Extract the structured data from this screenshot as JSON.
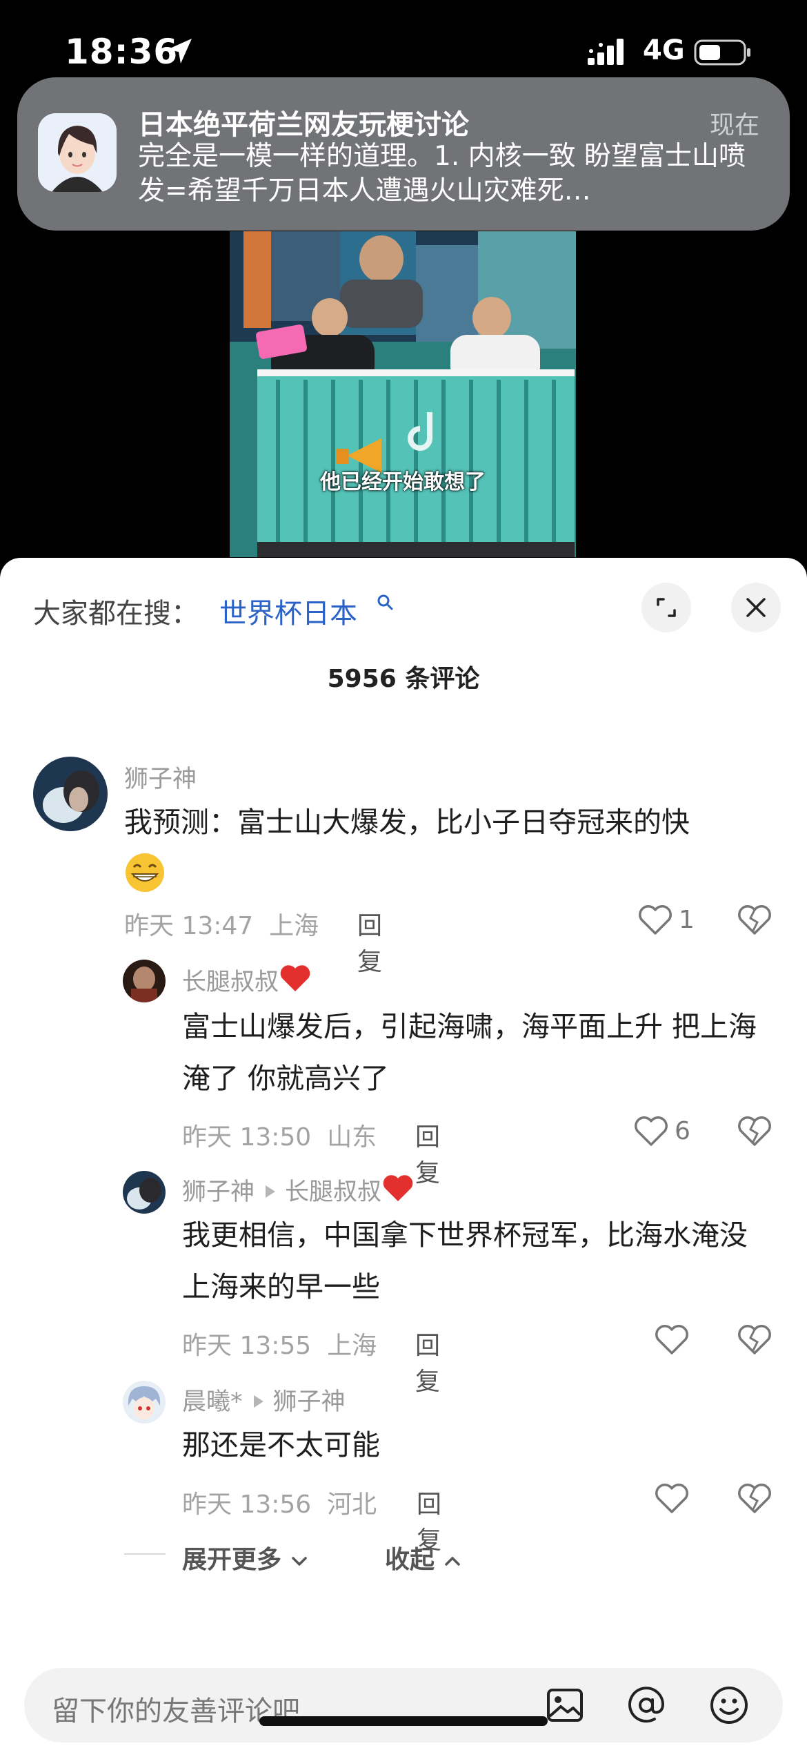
{
  "status_bar": {
    "time": "18:36",
    "network": "4G",
    "icons": [
      "location-arrow-icon",
      "signal-icon",
      "battery-icon"
    ]
  },
  "notification": {
    "title": "日本绝平荷兰网友玩梗讨论",
    "time": "现在",
    "body": "完全是一模一样的道理。1. 内核一致 盼望富士山喷发=希望千万日本人遭遇火山灾难死…"
  },
  "video": {
    "caption": "他已经开始敢想了",
    "icons": [
      "video-frame-image"
    ]
  },
  "sheet": {
    "search_label": "大家都在搜：",
    "search_term": "世界杯日本",
    "comment_count": "5956 条评论",
    "icons": [
      "search-icon",
      "expand-icon",
      "close-icon"
    ]
  },
  "comments": [
    {
      "name": "狮子神",
      "text": "我预测：富士山大爆发，比小子日夺冠来的快",
      "date": "昨天 13:47",
      "location": "上海",
      "reply_label": "回复",
      "likes": "1"
    },
    {
      "name": "长腿叔叔",
      "text": "富士山爆发后，引起海啸，海平面上升 把上海淹了 你就高兴了",
      "date": "昨天 13:50",
      "location": "山东",
      "reply_label": "回复",
      "likes": "6"
    },
    {
      "name": "狮子神",
      "reply_to": "长腿叔叔",
      "text": "我更相信，中国拿下世界杯冠军，比海水淹没上海来的早一些",
      "date": "昨天 13:55",
      "location": "上海",
      "reply_label": "回复",
      "likes": ""
    },
    {
      "name": "晨曦*",
      "reply_to": "狮子神",
      "text": "那还是不太可能",
      "date": "昨天 13:56",
      "location": "河北",
      "reply_label": "回复",
      "likes": ""
    }
  ],
  "expand_more": "展开更多",
  "collapse": "收起",
  "input": {
    "placeholder": "留下你的友善评论吧",
    "icons": [
      "image-icon",
      "at-icon",
      "emoji-icon"
    ]
  }
}
